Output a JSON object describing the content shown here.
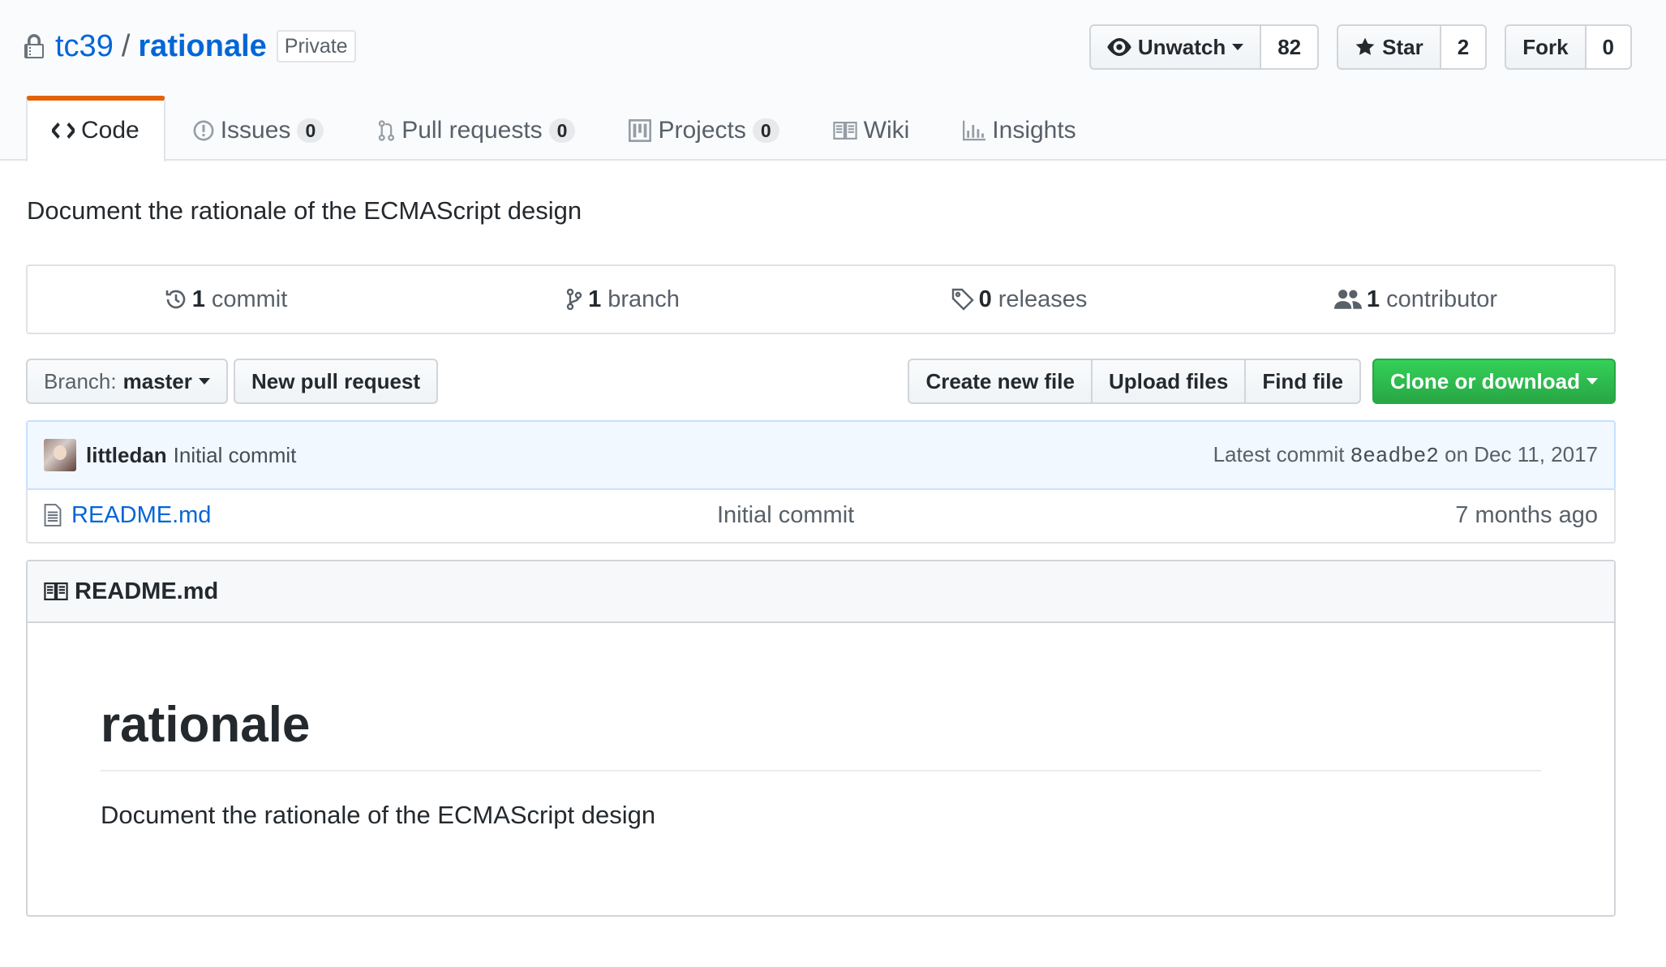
{
  "repo": {
    "owner": "tc39",
    "separator": "/",
    "name": "rationale",
    "visibility": "Private",
    "description": "Document the rationale of the ECMAScript design"
  },
  "social": {
    "watch_label": "Unwatch",
    "watch_count": "82",
    "star_label": "Star",
    "star_count": "2",
    "fork_label": "Fork",
    "fork_count": "0"
  },
  "tabs": [
    {
      "label": "Code",
      "icon": "code-icon",
      "selected": true
    },
    {
      "label": "Issues",
      "icon": "issue-icon",
      "count": "0"
    },
    {
      "label": "Pull requests",
      "icon": "pull-request-icon",
      "count": "0"
    },
    {
      "label": "Projects",
      "icon": "project-icon",
      "count": "0"
    },
    {
      "label": "Wiki",
      "icon": "book-icon"
    },
    {
      "label": "Insights",
      "icon": "graph-icon"
    }
  ],
  "summary": [
    {
      "num": "1",
      "label": "commit",
      "icon": "history-icon"
    },
    {
      "num": "1",
      "label": "branch",
      "icon": "branch-icon"
    },
    {
      "num": "0",
      "label": "releases",
      "icon": "tag-icon"
    },
    {
      "num": "1",
      "label": "contributor",
      "icon": "people-icon"
    }
  ],
  "file_nav": {
    "branch_prefix": "Branch:",
    "branch_name": "master",
    "new_pr": "New pull request",
    "create_file": "Create new file",
    "upload_files": "Upload files",
    "find_file": "Find file",
    "clone": "Clone or download"
  },
  "commit": {
    "author": "littledan",
    "message": "Initial commit",
    "latest_prefix": "Latest commit",
    "sha": "8eadbe2",
    "date": "on Dec 11, 2017"
  },
  "files": [
    {
      "name": "README.md",
      "message": "Initial commit",
      "age": "7 months ago"
    }
  ],
  "readme": {
    "header": "README.md",
    "title": "rationale",
    "text": "Document the rationale of the ECMAScript design"
  },
  "colors": {
    "link": "#0366d6",
    "tab_accent": "#e36209",
    "primary_button": "#28a745",
    "commit_tease_bg": "#f1f8ff"
  }
}
